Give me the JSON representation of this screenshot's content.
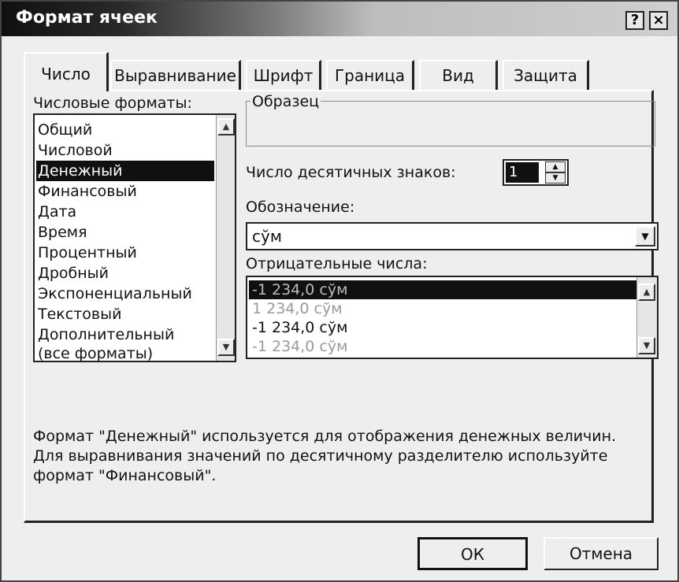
{
  "window": {
    "title": "Формат ячеек",
    "help_label": "?",
    "close_label": "×"
  },
  "tabs": [
    {
      "label": "Число"
    },
    {
      "label": "Выравнивание"
    },
    {
      "label": "Шрифт"
    },
    {
      "label": "Граница"
    },
    {
      "label": "Вид"
    },
    {
      "label": "Защита"
    }
  ],
  "formats": {
    "label": "Числовые форматы:",
    "items": [
      "Общий",
      "Числовой",
      "Денежный",
      "Финансовый",
      "Дата",
      "Время",
      "Процентный",
      "Дробный",
      "Экспоненциальный",
      "Текстовый",
      "Дополнительный",
      "(все форматы)"
    ],
    "selected_index": 2
  },
  "sample": {
    "label": "Образец",
    "value": ""
  },
  "decimals": {
    "label": "Число десятичных знаков:",
    "value": "1"
  },
  "symbol": {
    "label": "Обозначение:",
    "value": "сўм"
  },
  "negative": {
    "label": "Отрицательные числа:",
    "items": [
      "-1 234,0 сўм",
      "1 234,0 сўм",
      "-1 234,0 сўм",
      "-1 234,0 сўм"
    ],
    "selected_index": 0
  },
  "description": "Формат \"Денежный\" используется для отображения денежных величин. Для выравнивания значений по десятичному разделителю используйте формат \"Финансовый\".",
  "buttons": {
    "ok": "ОК",
    "cancel": "Отмена"
  },
  "colors": {
    "selection": "#101010",
    "negative_red": "#9a9a9a"
  }
}
